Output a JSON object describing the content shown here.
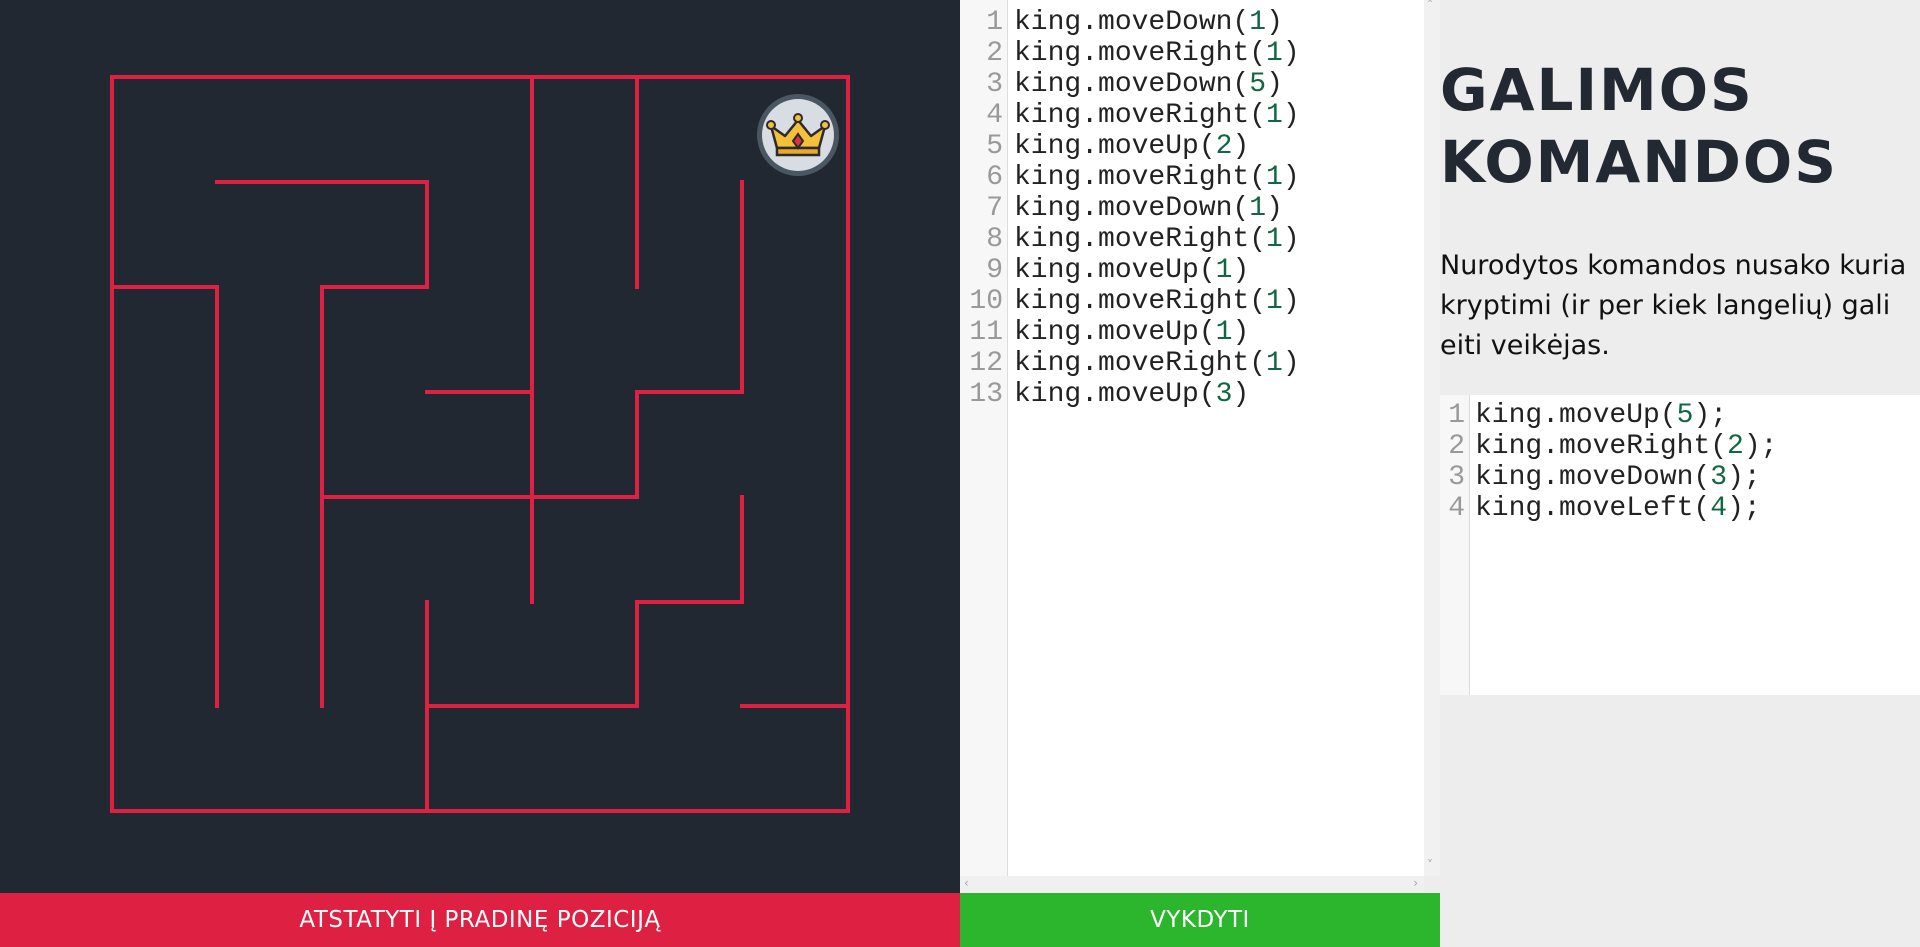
{
  "maze": {
    "colors": {
      "background": "#222831",
      "walls": "#de2042"
    },
    "character": {
      "name": "king",
      "icon": "crown-icon"
    }
  },
  "buttons": {
    "reset_label": "ATSTATYTI Į PRADINĘ POZICIJĄ",
    "run_label": "VYKDYTI",
    "reset_color": "#de2042",
    "run_color": "#2bb62e"
  },
  "editor": {
    "lines": [
      {
        "num": "1",
        "pre": "king.moveDown(",
        "arg": "1",
        "post": ")"
      },
      {
        "num": "2",
        "pre": "king.moveRight(",
        "arg": "1",
        "post": ")"
      },
      {
        "num": "3",
        "pre": "king.moveDown(",
        "arg": "5",
        "post": ")"
      },
      {
        "num": "4",
        "pre": "king.moveRight(",
        "arg": "1",
        "post": ")"
      },
      {
        "num": "5",
        "pre": "king.moveUp(",
        "arg": "2",
        "post": ")"
      },
      {
        "num": "6",
        "pre": "king.moveRight(",
        "arg": "1",
        "post": ")"
      },
      {
        "num": "7",
        "pre": "king.moveDown(",
        "arg": "1",
        "post": ")"
      },
      {
        "num": "8",
        "pre": "king.moveRight(",
        "arg": "1",
        "post": ")"
      },
      {
        "num": "9",
        "pre": "king.moveUp(",
        "arg": "1",
        "post": ")"
      },
      {
        "num": "10",
        "pre": "king.moveRight(",
        "arg": "1",
        "post": ")"
      },
      {
        "num": "11",
        "pre": "king.moveUp(",
        "arg": "1",
        "post": ")"
      },
      {
        "num": "12",
        "pre": "king.moveRight(",
        "arg": "1",
        "post": ")"
      },
      {
        "num": "13",
        "pre": "king.moveUp(",
        "arg": "3",
        "post": ")"
      }
    ]
  },
  "help": {
    "title_line1": "GALIMOS",
    "title_line2": "KOMANDOS",
    "description": "Nurodytos komandos nusako kuria kryptimi (ir per kiek langelių) gali eiti veikėjas.",
    "examples": [
      {
        "num": "1",
        "pre": "king.moveUp(",
        "arg": "5",
        "post": ");"
      },
      {
        "num": "2",
        "pre": "king.moveRight(",
        "arg": "2",
        "post": ");"
      },
      {
        "num": "3",
        "pre": "king.moveDown(",
        "arg": "3",
        "post": ");"
      },
      {
        "num": "4",
        "pre": "king.moveLeft(",
        "arg": "4",
        "post": ");"
      }
    ]
  }
}
